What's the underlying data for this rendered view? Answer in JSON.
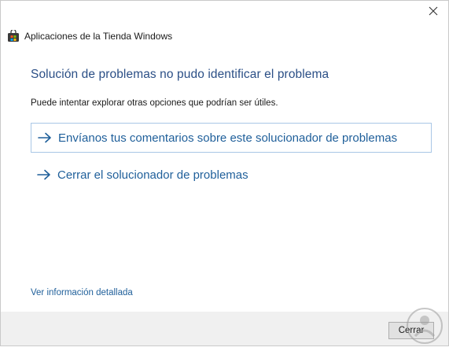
{
  "window": {
    "title": "Aplicaciones de la Tienda Windows",
    "close_glyph": "✕"
  },
  "main": {
    "heading": "Solución de problemas no pudo identificar el problema",
    "subtext": "Puede intentar explorar otras opciones que podrían ser útiles.",
    "options": [
      {
        "label": "Envíanos tus comentarios sobre este solucionador de problemas",
        "icon": "arrow-right-icon"
      },
      {
        "label": "Cerrar el solucionador de problemas",
        "icon": "arrow-right-icon"
      }
    ],
    "detail_link": "Ver información detallada"
  },
  "footer": {
    "close_label": "Cerrar"
  },
  "colors": {
    "heading": "#2b4f86",
    "link": "#1f5f9a",
    "focus_border": "#a9c7e6",
    "footer_bg": "#f0f0f0"
  }
}
